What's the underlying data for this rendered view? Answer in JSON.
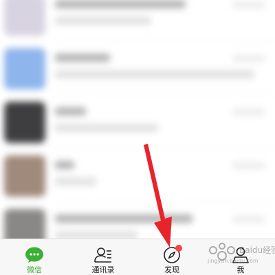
{
  "tabs": [
    {
      "label": "微信",
      "icon": "chat-bubble-icon",
      "active": true
    },
    {
      "label": "通讯录",
      "icon": "contacts-icon",
      "active": false
    },
    {
      "label": "发现",
      "icon": "compass-icon",
      "active": false,
      "badge": "red-dot"
    },
    {
      "label": "我",
      "icon": "person-icon",
      "active": false
    }
  ],
  "colors": {
    "active_tab": "#3cb034",
    "badge": "#f04848",
    "annotation_arrow": "#e8242b"
  },
  "watermark": {
    "logo_text": "Baidu经验",
    "url": "jingyan.baidu.com"
  }
}
